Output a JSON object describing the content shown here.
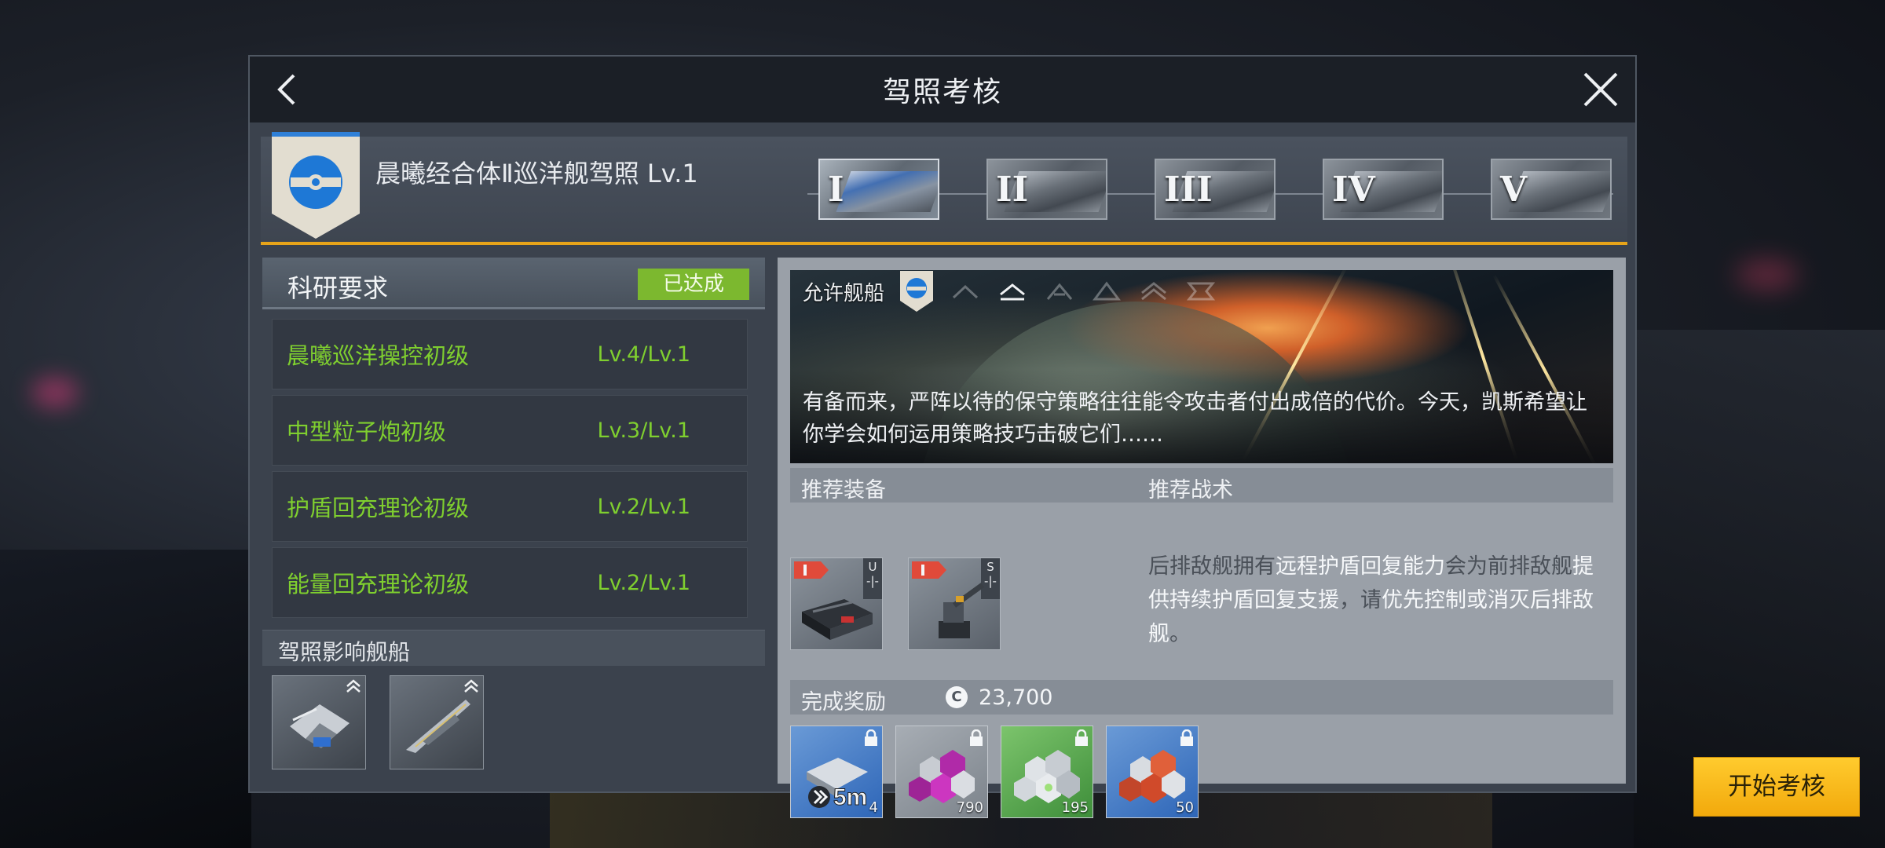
{
  "dialog": {
    "title": "驾照考核"
  },
  "license": {
    "name": "晨曦经合体Ⅱ巡洋舰驾照 Lv.1",
    "tiers": [
      {
        "numeral": "I",
        "active": true
      },
      {
        "numeral": "II",
        "active": false
      },
      {
        "numeral": "III",
        "active": false
      },
      {
        "numeral": "IV",
        "active": false
      },
      {
        "numeral": "V",
        "active": false
      }
    ]
  },
  "research": {
    "header": "科研要求",
    "status": "已达成",
    "items": [
      {
        "name": "晨曦巡洋操控初级",
        "level": "Lv.4/Lv.1"
      },
      {
        "name": "中型粒子炮初级",
        "level": "Lv.3/Lv.1"
      },
      {
        "name": "护盾回充理论初级",
        "level": "Lv.2/Lv.1"
      },
      {
        "name": "能量回充理论初级",
        "level": "Lv.2/Lv.1"
      }
    ]
  },
  "affected_ships": {
    "header": "驾照影响舰船"
  },
  "mission": {
    "allowed_label": "允许舰船",
    "description": "有备而来，严阵以待的保守策略往往能令攻击者付出成倍的代价。今天，凯斯希望让你学会如何运用策略技巧击破它们……"
  },
  "equipment": {
    "header": "推荐装备",
    "items": [
      {
        "tier": "I",
        "grade": "U"
      },
      {
        "tier": "I",
        "grade": "S"
      }
    ]
  },
  "tactics": {
    "header": "推荐战术",
    "text_parts": [
      "后排敌舰拥有",
      "远程护盾回复能力",
      "会为前排敌舰",
      "提供持续护盾回复支援",
      "，请",
      "优先控制或消灭后排敌舰",
      "。"
    ]
  },
  "rewards": {
    "header": "完成奖励",
    "currency_symbol": "C",
    "currency_amount": "23,700",
    "items": [
      {
        "icon": "speedup-icon",
        "label": "5m",
        "qty": "4"
      },
      {
        "icon": "purple-ore-icon",
        "qty": "790"
      },
      {
        "icon": "green-ore-icon",
        "qty": "195"
      },
      {
        "icon": "orange-ore-icon",
        "qty": "50"
      }
    ]
  },
  "actions": {
    "start_label": "开始考核"
  },
  "colors": {
    "accent_gold": "#e7a41a",
    "achieved_green": "#7cb82f",
    "requirement_text": "#7fcf2f",
    "start_button": "#ffc21c"
  }
}
